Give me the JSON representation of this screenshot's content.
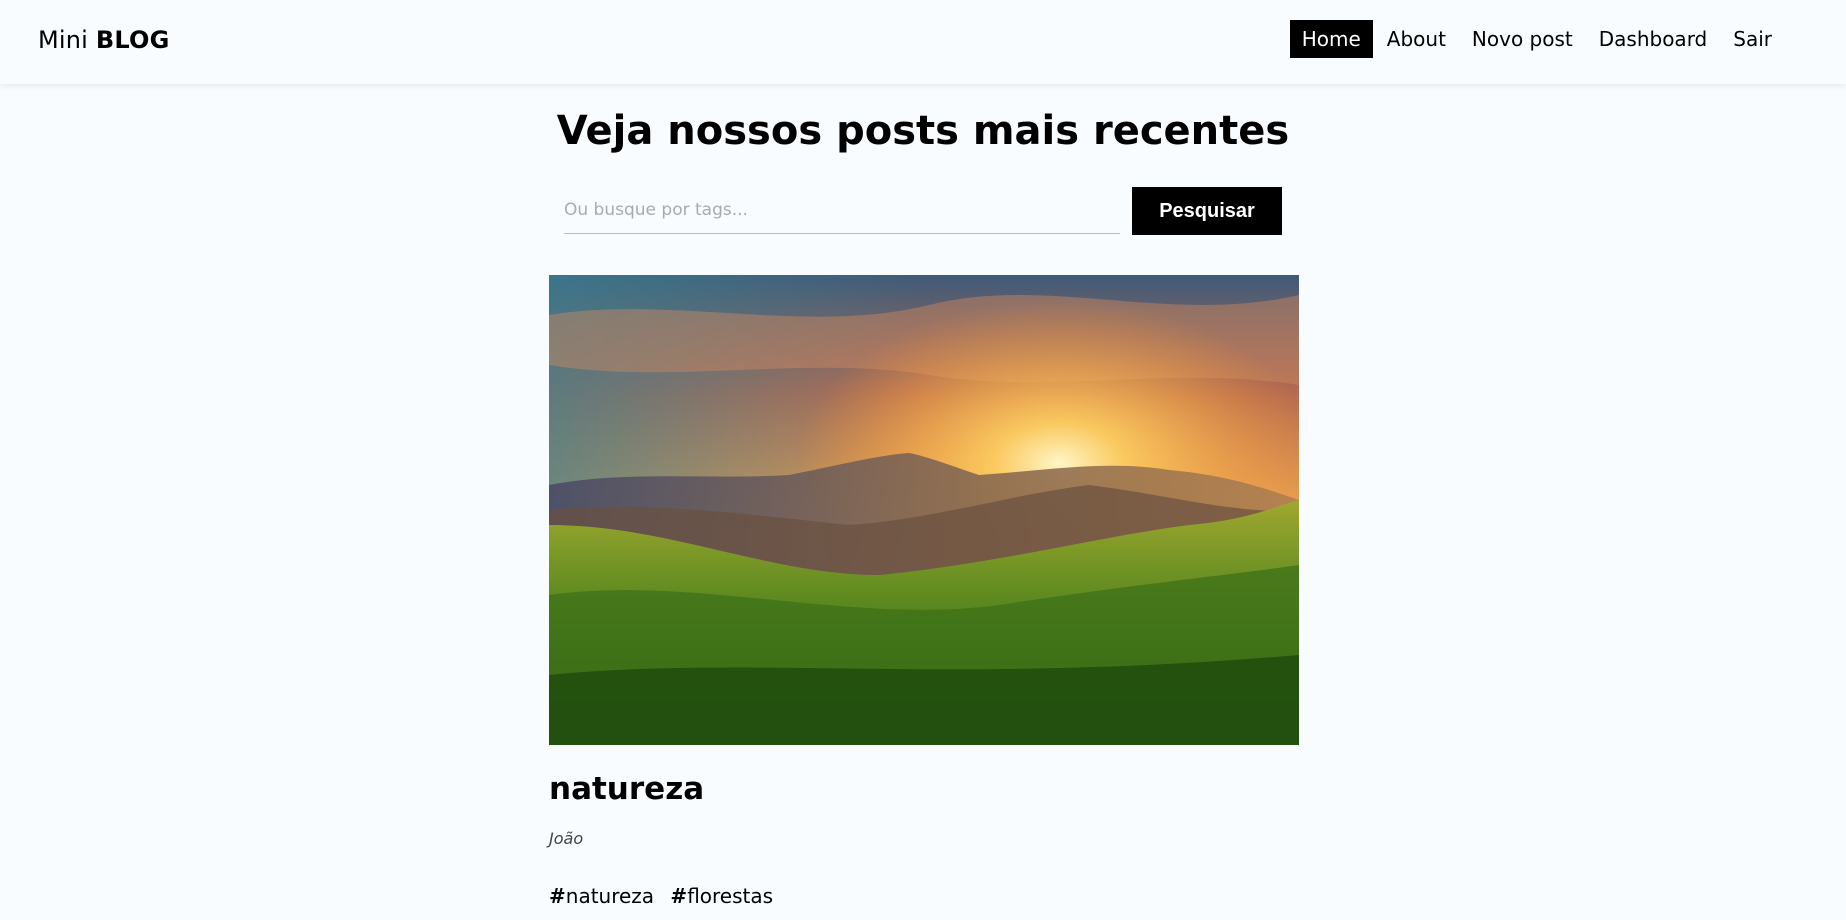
{
  "brand": {
    "light": "Mini",
    "bold": "BLOG"
  },
  "nav": {
    "items": [
      "Home",
      "About",
      "Novo post",
      "Dashboard",
      "Sair"
    ],
    "active": "Home"
  },
  "main": {
    "title": "Veja nossos posts mais recentes"
  },
  "search": {
    "placeholder": "Ou busque por tags...",
    "value": "",
    "button_label": "Pesquisar"
  },
  "post": {
    "title": "natureza",
    "author": "João",
    "tags": [
      "natureza",
      "florestas"
    ]
  },
  "colors": {
    "background": "#f8fcff",
    "accent": "#000000",
    "button_text": "#ffffff"
  }
}
